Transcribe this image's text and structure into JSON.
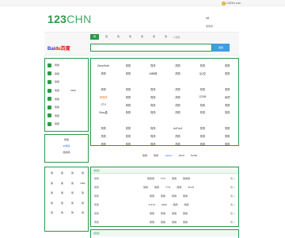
{
  "top_bar": {
    "weather": "123Chn.com"
  },
  "logo": {
    "main": "123",
    "rest": "CHN"
  },
  "head_right": {
    "line1": "AB",
    "line2": "简简简"
  },
  "search": {
    "tabs": [
      "网",
      "简",
      "简",
      "简",
      "简",
      "简",
      "简"
    ],
    "more": "▾ 简简",
    "engine_logo_a": "Bai",
    "engine_logo_b": "du百度",
    "button": "简简",
    "value": ""
  },
  "sidebar": [
    {
      "label": "简简",
      "extra": "",
      "color": "#2a9a47"
    },
    {
      "label": "简简",
      "extra": "",
      "color": "#2a9a47"
    },
    {
      "label": "简简",
      "extra": "",
      "color": "#2a9a47"
    },
    {
      "label": "简简",
      "extra": "4399",
      "color": "#2a9a47"
    },
    {
      "label": "简简",
      "extra": "",
      "color": "#2a9a47"
    },
    {
      "label": "简简",
      "extra": "",
      "color": "#2a9a47"
    },
    {
      "label": "简简",
      "extra": "",
      "color": "#2a9a47"
    },
    {
      "label": "简简",
      "extra": "",
      "color": "#2a9a47"
    }
  ],
  "main_grid": [
    [
      "DeepSeek",
      "简简",
      "简简",
      "简简",
      "简简",
      "简简"
    ],
    [
      "简简",
      "简简",
      "1688网",
      "简简",
      "QQ空",
      "简简"
    ],
    [
      "简简",
      "简简",
      "简简",
      "简简",
      "简简",
      "简简"
    ],
    [
      "简简简",
      "简简",
      "简简",
      "简简",
      "12306",
      "58同"
    ],
    [
      "CTV",
      "简简",
      "简简",
      "简简",
      "简简",
      "简简"
    ],
    [
      "Boss直",
      "简简",
      "简简",
      "简简",
      "简简",
      "简简"
    ],
    [
      "简简",
      "简简",
      "简简",
      "AuFun3",
      "简简",
      "简简"
    ],
    [
      "简简",
      "简简",
      "简简",
      "简简",
      "简简",
      "简简"
    ],
    [
      "简简",
      "简简",
      "简简",
      "简简",
      "简简",
      "简简"
    ]
  ],
  "lower_left": {
    "line1": "简简",
    "line2": "IP简简",
    "line3": "简简简"
  },
  "quick_links": [
    "简简",
    "简简",
    "mailme",
    "WHO",
    "NASE"
  ],
  "bottom_left": [
    [
      "简",
      "简",
      "简",
      "简"
    ],
    [
      "简",
      "简",
      "简",
      "NBA"
    ],
    [
      "简",
      "简",
      "简",
      "简"
    ],
    [
      "简",
      "简",
      "简",
      "简"
    ],
    [
      "简",
      "简",
      "简",
      "简"
    ]
  ],
  "news": {
    "head": "[简简]",
    "rows": [
      {
        "label": "简简",
        "items": [
          "简简简",
          "CTV",
          "简简",
          "简简简"
        ],
        "more": "简 »"
      },
      {
        "label": "简简",
        "items": [
          "简简",
          "简简",
          "YYG",
          "简简",
          "21CN"
        ],
        "more": "简 »"
      },
      {
        "label": "简简",
        "items": [
          "简简",
          "简简",
          "简简",
          "简简"
        ],
        "more": "简 »"
      },
      {
        "label": "简简",
        "items": [
          "17173",
          "4399",
          "简简",
          "简简"
        ],
        "more": "简 »"
      },
      {
        "label": "简简",
        "items": [
          "简简",
          "简简",
          "简简",
          "简简"
        ],
        "more": "简 »"
      },
      {
        "label": "简简",
        "items": [
          "简简",
          "简简",
          "简简",
          "简简"
        ],
        "more": "简 »"
      }
    ],
    "head2": "[简简]"
  }
}
